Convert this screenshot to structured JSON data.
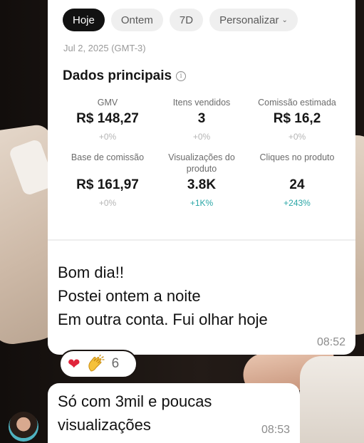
{
  "dashboard": {
    "tabs": [
      {
        "label": "Hoje",
        "active": true
      },
      {
        "label": "Ontem",
        "active": false
      },
      {
        "label": "7D",
        "active": false
      },
      {
        "label": "Personalizar",
        "active": false
      }
    ],
    "date": "Jul 2, 2025 (GMT-3)",
    "section_title": "Dados principais",
    "metrics": [
      {
        "label": "GMV",
        "value": "R$ 148,27",
        "change": "+0%"
      },
      {
        "label": "Itens vendidos",
        "value": "3",
        "change": "+0%"
      },
      {
        "label": "Comissão estimada",
        "value": "R$ 16,2",
        "change": "+0%"
      },
      {
        "label": "Base de comissão",
        "value": "R$ 161,97",
        "change": "+0%"
      },
      {
        "label": "Visualizações do produto",
        "value": "3.8K",
        "change": "+1K%"
      },
      {
        "label": "Cliques no produto",
        "value": "24",
        "change": "+243%"
      }
    ]
  },
  "messages": [
    {
      "lines": [
        "Bom dia!!",
        "Postei ontem a noite",
        "Em outra conta. Fui olhar hoje"
      ],
      "time": "08:52"
    },
    {
      "lines": [
        "Só com 3mil e poucas",
        "visualizações"
      ],
      "time": "08:53"
    }
  ],
  "reactions": {
    "emojis": [
      "red-heart",
      "clapping-hands"
    ],
    "count": "6"
  },
  "colors": {
    "positive_change": "#2aa6a6",
    "active_tab": "#121212",
    "heart": "#e0243a"
  }
}
